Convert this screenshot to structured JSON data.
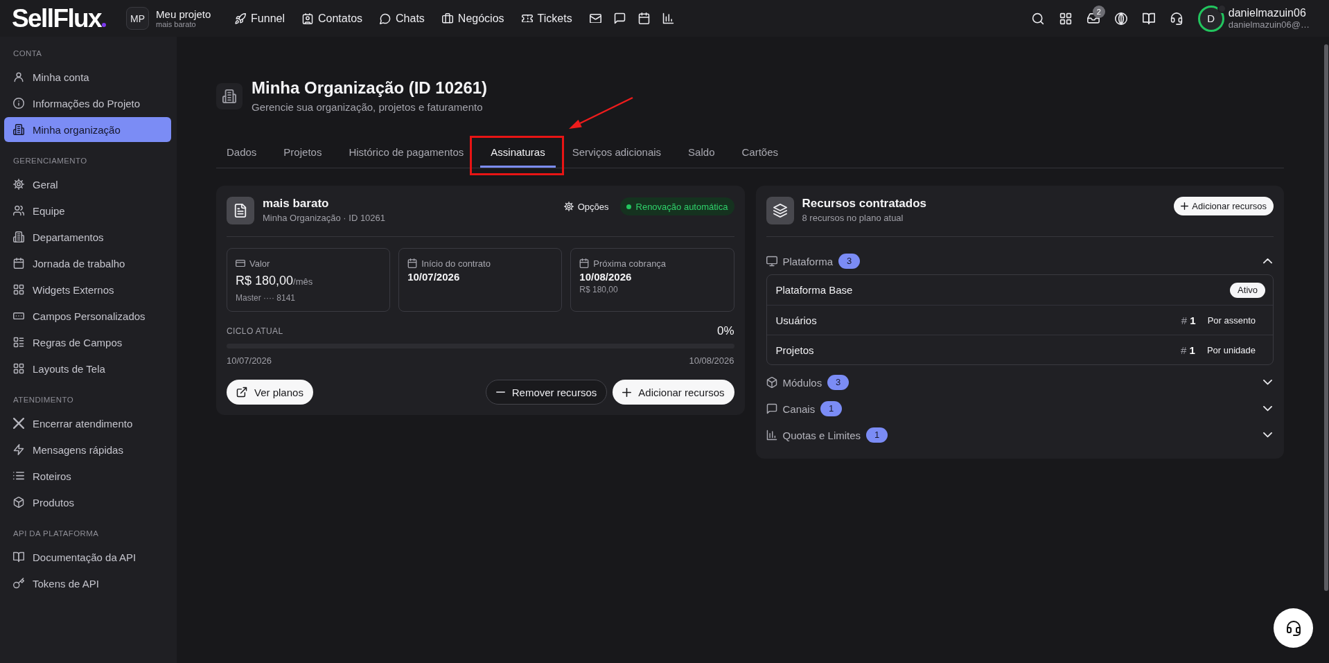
{
  "topbar": {
    "logo": "SellFlux",
    "project": {
      "initials": "MP",
      "name": "Meu projeto",
      "plan": "mais barato"
    },
    "nav": [
      {
        "label": "Funnel"
      },
      {
        "label": "Contatos"
      },
      {
        "label": "Chats"
      },
      {
        "label": "Negócios"
      },
      {
        "label": "Tickets"
      }
    ],
    "inbox_count": "2",
    "user": {
      "initial": "D",
      "name": "danielmazuin06",
      "email": "danielmazuin06@…"
    }
  },
  "sidebar": {
    "sections": [
      {
        "title": "CONTA",
        "items": [
          {
            "label": "Minha conta",
            "selected": false
          },
          {
            "label": "Informações do Projeto",
            "selected": false
          },
          {
            "label": "Minha organização",
            "selected": true
          }
        ]
      },
      {
        "title": "GERENCIAMENTO",
        "items": [
          {
            "label": "Geral",
            "selected": false
          },
          {
            "label": "Equipe",
            "selected": false
          },
          {
            "label": "Departamentos",
            "selected": false
          },
          {
            "label": "Jornada de trabalho",
            "selected": false
          },
          {
            "label": "Widgets Externos",
            "selected": false
          },
          {
            "label": "Campos Personalizados",
            "selected": false
          },
          {
            "label": "Regras de Campos",
            "selected": false
          },
          {
            "label": "Layouts de Tela",
            "selected": false
          }
        ]
      },
      {
        "title": "ATENDIMENTO",
        "items": [
          {
            "label": "Encerrar atendimento",
            "selected": false
          },
          {
            "label": "Mensagens rápidas",
            "selected": false
          },
          {
            "label": "Roteiros",
            "selected": false
          },
          {
            "label": "Produtos",
            "selected": false
          }
        ]
      },
      {
        "title": "API DA PLATAFORMA",
        "items": [
          {
            "label": "Documentação da API",
            "selected": false
          },
          {
            "label": "Tokens de API",
            "selected": false
          }
        ]
      }
    ]
  },
  "page_header": {
    "title": "Minha Organização (ID 10261)",
    "subtitle": "Gerencie sua organização, projetos e faturamento"
  },
  "tabs": [
    {
      "label": "Dados",
      "selected": false
    },
    {
      "label": "Projetos",
      "selected": false
    },
    {
      "label": "Histórico de pagamentos",
      "selected": false
    },
    {
      "label": "Assinaturas",
      "selected": true
    },
    {
      "label": "Serviços adicionais",
      "selected": false
    },
    {
      "label": "Saldo",
      "selected": false
    },
    {
      "label": "Cartões",
      "selected": false
    }
  ],
  "subscription": {
    "name": "mais barato",
    "subtitle": "Minha Organização · ID 10261",
    "options_label": "Opções",
    "renewal_label": "Renovação automática",
    "stats": [
      {
        "kind": "amount",
        "label": "Valor",
        "value": "R$ 180,00",
        "unit": "/mês",
        "detail": "Master ···· 8141"
      },
      {
        "kind": "date",
        "label": "Início do contrato",
        "value": "10/07/2026"
      },
      {
        "kind": "date",
        "label": "Próxima cobrança",
        "value": "10/08/2026",
        "detail": "R$ 180,00"
      }
    ],
    "cycle": {
      "label": "CICLO ATUAL",
      "percent": "0%",
      "level": 0,
      "start": "10/07/2026",
      "end": "10/08/2026"
    },
    "buttons": [
      {
        "kind": "link",
        "label": "Ver planos"
      },
      {
        "kind": "remove",
        "label": "Remover recursos"
      },
      {
        "kind": "add",
        "label": "Adicionar recursos"
      }
    ]
  },
  "resources": {
    "title": "Recursos contratados",
    "subtitle": "8 recursos no plano atual",
    "add_label": "Adicionar recursos",
    "groups": [
      {
        "label": "Plataforma",
        "count": "3",
        "expanded": true,
        "rows": [
          {
            "kind": "status",
            "name": "Plataforma Base",
            "status": "Ativo"
          },
          {
            "kind": "quantity",
            "name": "Usuários",
            "quantity": "# **1**",
            "unit": "Por assento"
          },
          {
            "kind": "quantity",
            "name": "Projetos",
            "quantity": "# **1**",
            "unit": "Por unidade"
          }
        ]
      },
      {
        "label": "Módulos",
        "count": "3",
        "expanded": false
      },
      {
        "label": "Canais",
        "count": "1",
        "expanded": false
      },
      {
        "label": "Quotas e Limites",
        "count": "1",
        "expanded": false
      }
    ]
  }
}
